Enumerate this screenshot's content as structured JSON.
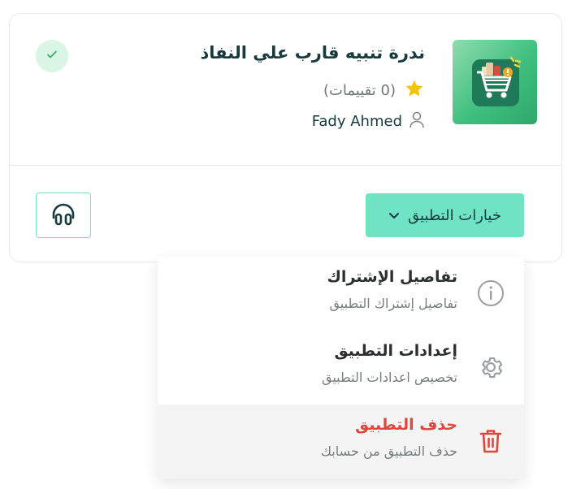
{
  "app": {
    "title": "ندرة تنبيه قارب علي النفاذ",
    "rating_text": "(0 تقييمات)",
    "author": "Fady Ahmed"
  },
  "actions": {
    "options_label": "خيارات التطبيق"
  },
  "menu": {
    "items": [
      {
        "title": "تفاصيل الإشتراك",
        "subtitle": "تفاصيل إشتراك التطبيق",
        "icon": "info-icon"
      },
      {
        "title": "إعدادات التطبيق",
        "subtitle": "تخصيص اعدادات التطبيق",
        "icon": "gear-icon"
      },
      {
        "title": "حذف التطبيق",
        "subtitle": "حذف التطبيق من حسابك",
        "icon": "trash-icon"
      }
    ]
  },
  "colors": {
    "accent": "#6fe3c4",
    "title": "#173a3d",
    "danger": "#e0463e",
    "star": "#f5c400",
    "check_bg": "#d9f5e6"
  }
}
